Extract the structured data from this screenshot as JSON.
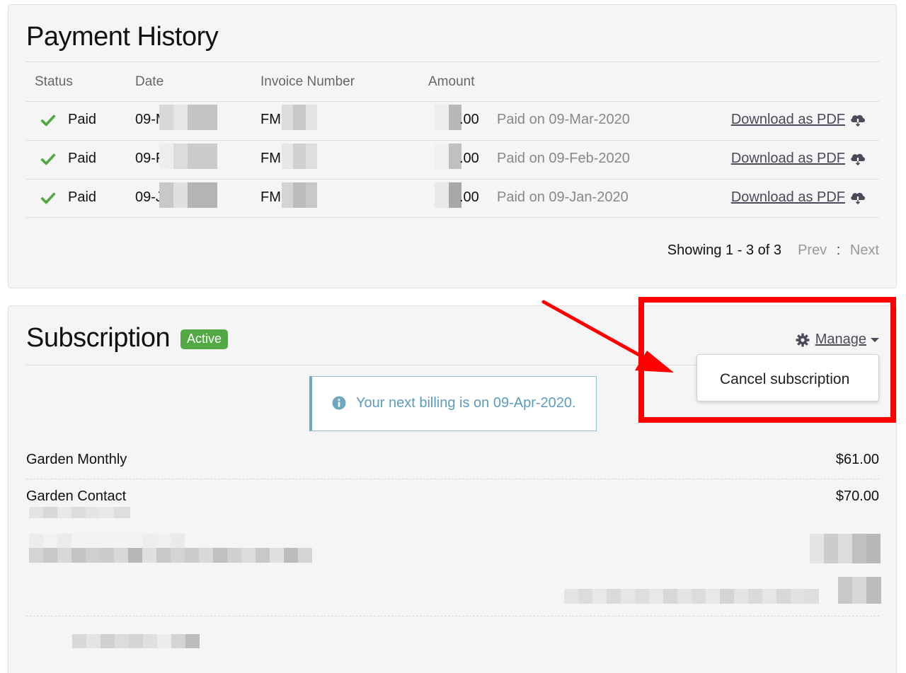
{
  "payment_history": {
    "title": "Payment History",
    "columns": {
      "status": "Status",
      "date": "Date",
      "invoice": "Invoice Number",
      "amount": "Amount"
    },
    "rows": [
      {
        "status": "Paid",
        "date": "09-M",
        "invoice": "FM",
        "amount": ".00",
        "paid_on": "Paid on 09-Mar-2020",
        "download": "Download as PDF"
      },
      {
        "status": "Paid",
        "date": "09-F",
        "invoice": "FM",
        "amount": ".00",
        "paid_on": "Paid on 09-Feb-2020",
        "download": "Download as PDF"
      },
      {
        "status": "Paid",
        "date": "09-J",
        "invoice": "FM",
        "amount": ".00",
        "paid_on": "Paid on 09-Jan-2020",
        "download": "Download as PDF"
      }
    ],
    "showing": "Showing 1 - 3 of 3",
    "prev": "Prev",
    "separator": ":",
    "next": "Next"
  },
  "subscription": {
    "title": "Subscription",
    "badge": "Active",
    "manage": "Manage",
    "dropdown_item": "Cancel subscription",
    "billing_notice": "Your next billing is on 09-Apr-2020.",
    "items": [
      {
        "name": "Garden Monthly",
        "price": "$61.00"
      },
      {
        "name": "Garden Contact",
        "price": "$70.00"
      }
    ]
  },
  "colors": {
    "check": "#52a944",
    "badge": "#52a944",
    "annotation": "#ff0000",
    "info": "#5c9cba"
  },
  "icons": {
    "check": "check-icon",
    "cloud_download": "cloud-download-icon",
    "gear": "gear-icon",
    "info": "info-circle-icon",
    "caret": "chevron-down-icon"
  }
}
